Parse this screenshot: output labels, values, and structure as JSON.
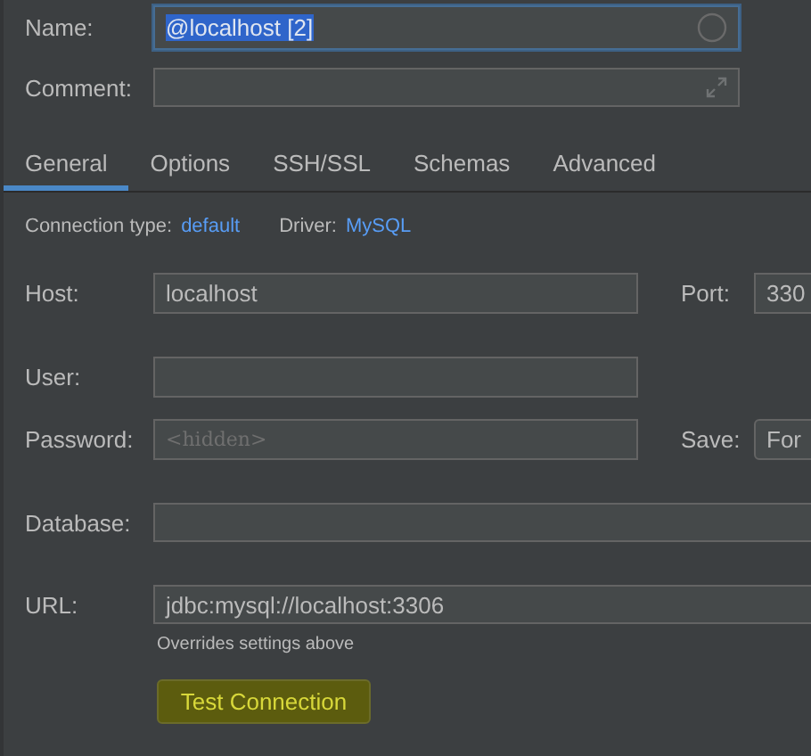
{
  "name": {
    "label": "Name:",
    "value": "@localhost [2]",
    "text_selected": true,
    "focused": true
  },
  "comment": {
    "label": "Comment:"
  },
  "tabs": [
    {
      "label": "General",
      "selected": true
    },
    {
      "label": "Options",
      "selected": false
    },
    {
      "label": "SSH/SSL",
      "selected": false
    },
    {
      "label": "Schemas",
      "selected": false
    },
    {
      "label": "Advanced",
      "selected": false
    }
  ],
  "connection": {
    "type_label": "Connection type:",
    "type": "default",
    "driver_label": "Driver:",
    "driver": "MySQL"
  },
  "host": {
    "label": "Host:",
    "value": "localhost",
    "port_label": "Port:",
    "port": "330"
  },
  "user": {
    "label": "User:"
  },
  "password": {
    "label": "Password:",
    "placeholder": "<hidden>",
    "save_label": "Save:",
    "save": "For"
  },
  "database": {
    "label": "Database:"
  },
  "url": {
    "label": "URL:",
    "value": "jdbc:mysql://localhost:3306",
    "hint": "Overrides settings above"
  },
  "test_button": {
    "label": "Test Connection",
    "highlighted": true
  }
}
